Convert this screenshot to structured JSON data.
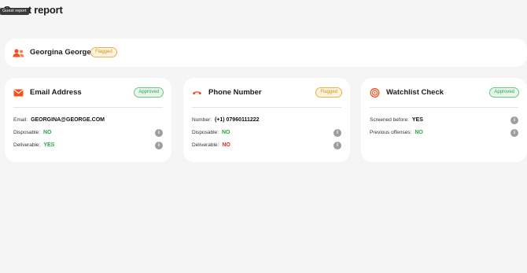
{
  "page": {
    "title": "Guest report",
    "tooltip": "Guest report"
  },
  "guest": {
    "name": "Georgina George",
    "status": "Flagged",
    "icon": "user-group-icon"
  },
  "colors": {
    "accent": "#f4511e",
    "green": "#28a745",
    "red": "#e0282d",
    "flagged": "#d4920f"
  },
  "cards": {
    "email": {
      "title": "Email Address",
      "status": "Approved",
      "icon": "envelope-icon",
      "rows": [
        {
          "label": "Email:",
          "value": "GEORGINA@GEORGE.COM"
        },
        {
          "label": "Disposable:",
          "value": "NO"
        },
        {
          "label": "Deliverable:",
          "value": "YES"
        }
      ]
    },
    "phone": {
      "title": "Phone Number",
      "status": "Flagged",
      "icon": "phone-icon",
      "rows": [
        {
          "label": "Number:",
          "value": "(+1) 07960111222"
        },
        {
          "label": "Disposable:",
          "value": "NO"
        },
        {
          "label": "Deliverable:",
          "value": "NO"
        }
      ]
    },
    "watchlist": {
      "title": "Watchlist Check",
      "status": "Approved",
      "icon": "target-icon",
      "rows": [
        {
          "label": "Screened before:",
          "value": "YES"
        },
        {
          "label": "Previous offenses:",
          "value": "NO"
        }
      ]
    }
  },
  "info_glyph": "i"
}
